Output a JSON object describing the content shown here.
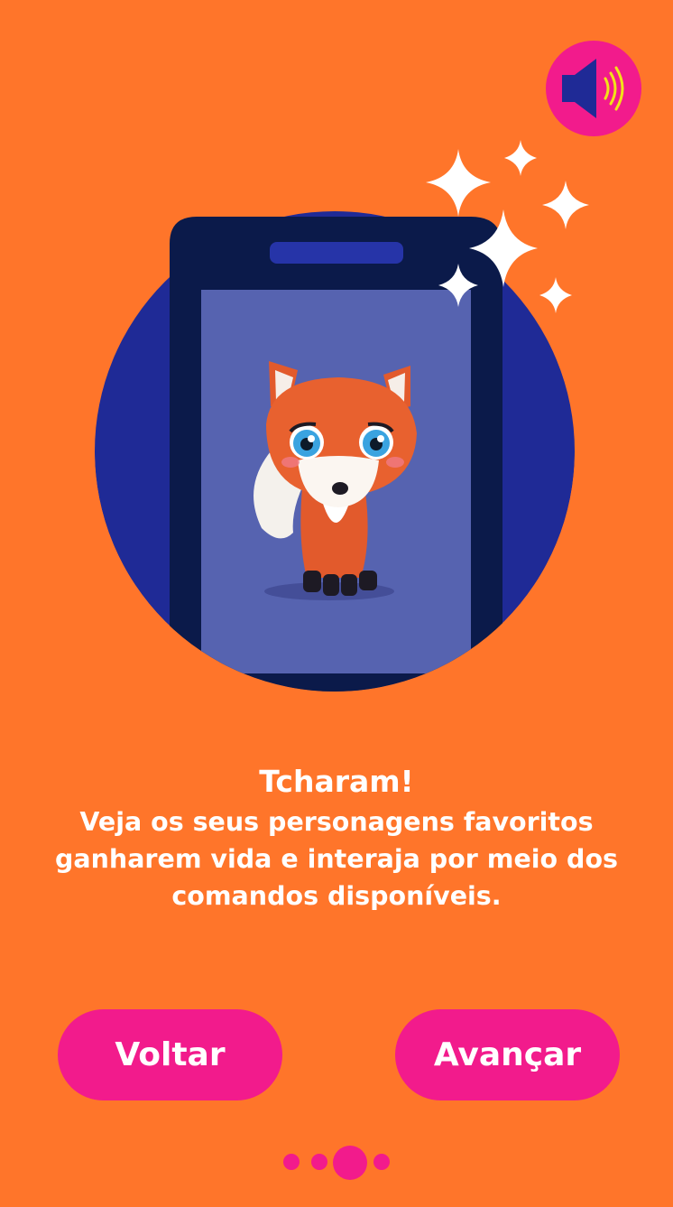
{
  "header": {
    "sound_icon": "speaker-volume-icon"
  },
  "illustration": {
    "phone_icon": "smartphone",
    "character": "fox-3d-character",
    "sparkles_icon": "sparkles",
    "colors": {
      "circle": "#1f2a96",
      "phone_body": "#0b1a4a",
      "phone_screen": "#5663b0",
      "accent": "#f21b8c",
      "background": "#ff752a"
    }
  },
  "content": {
    "title": "Tcharam!",
    "body": "Veja os seus personagens favoritos ganharem vida e interaja por meio dos comandos disponíveis."
  },
  "navigation": {
    "back_label": "Voltar",
    "next_label": "Avançar"
  },
  "pagination": {
    "total": 4,
    "current": 3
  }
}
